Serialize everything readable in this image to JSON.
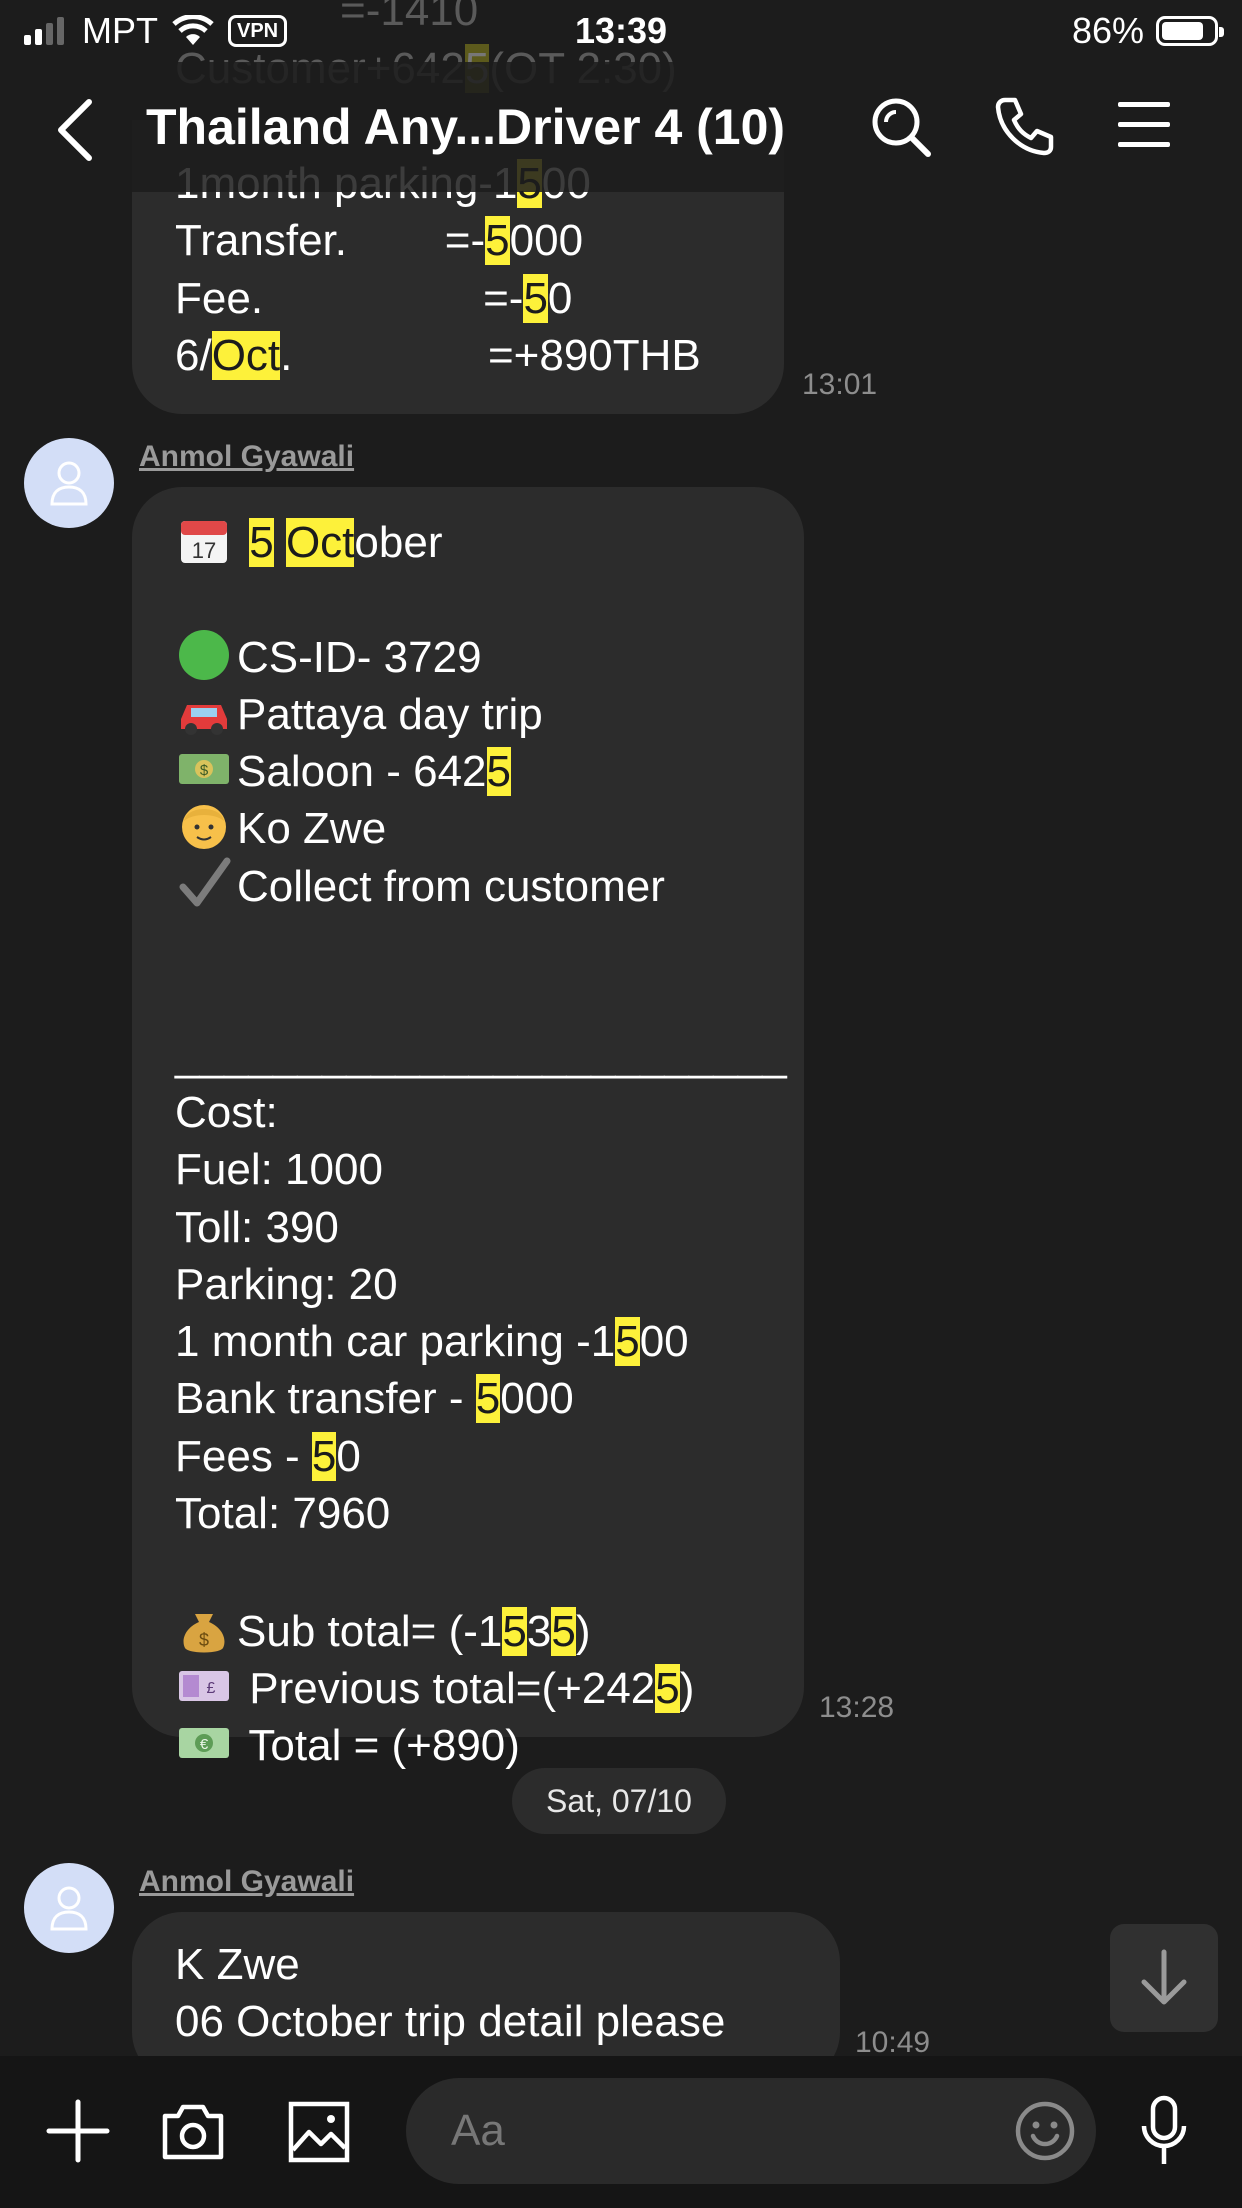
{
  "status_bar": {
    "carrier": "MPT",
    "vpn_label": "VPN",
    "time": "13:39",
    "battery": "86%",
    "battery_level": 0.86
  },
  "header": {
    "title": "Thailand Any...Driver 4 (10)"
  },
  "ghost_lines": [
    "=-1410",
    "Customer+642",
    "5",
    "(OT 2:30)"
  ],
  "messages": [
    {
      "sender": "",
      "time": "13:01",
      "lines": [
        [
          "1month parking-1",
          {
            "h": "5"
          },
          "00"
        ],
        [
          "Transfer.        =-",
          {
            "h": "5"
          },
          "000"
        ],
        [
          "Fee.                  =-",
          {
            "h": "5"
          },
          "0"
        ],
        [
          "6/",
          {
            "h": "Oct"
          },
          ".                =+890THB"
        ]
      ]
    },
    {
      "sender": "Anmol Gyawali",
      "time": "13:28",
      "lines": [
        [
          {
            "e": "calendar-icon"
          },
          " ",
          {
            "h": "5"
          },
          " ",
          {
            "h": "Oct"
          },
          "ober"
        ],
        [
          ""
        ],
        [
          {
            "e": "green-circle-icon"
          },
          "CS-ID- 3729"
        ],
        [
          {
            "e": "car-icon"
          },
          "Pattaya day trip"
        ],
        [
          {
            "e": "money-icon"
          },
          "Saloon - 642",
          {
            "h": "5"
          }
        ],
        [
          {
            "e": "person-icon"
          },
          "Ko Zwe"
        ],
        [
          {
            "e": "check-icon"
          },
          "Collect from customer"
        ],
        [
          ""
        ],
        [
          ""
        ],
        [
          "_________________________"
        ],
        [
          "Cost:"
        ],
        [
          "Fuel: 1000"
        ],
        [
          "Toll: 390"
        ],
        [
          "Parking: 20"
        ],
        [
          "1 month car parking -1",
          {
            "h": "5"
          },
          "00"
        ],
        [
          "Bank transfer - ",
          {
            "h": "5"
          },
          "000"
        ],
        [
          "Fees - ",
          {
            "h": "5"
          },
          "0"
        ],
        [
          "Total: 7960"
        ],
        [
          ""
        ],
        [
          {
            "e": "money-bag-icon"
          },
          "Sub total= (-1",
          {
            "h": "5"
          },
          "3",
          {
            "h": "5"
          },
          ")"
        ],
        [
          {
            "e": "pound-note-icon"
          },
          " Previous total=(+242",
          {
            "h": "5"
          },
          ")"
        ],
        [
          {
            "e": "euro-note-icon"
          },
          " Total = (+890)"
        ]
      ]
    },
    {
      "sender": "Anmol Gyawali",
      "time": "10:49",
      "lines": [
        [
          "K Zwe"
        ],
        [
          "06 October trip detail please"
        ]
      ]
    }
  ],
  "date_divider": "Sat, 07/10",
  "composer": {
    "placeholder": "Aa"
  }
}
